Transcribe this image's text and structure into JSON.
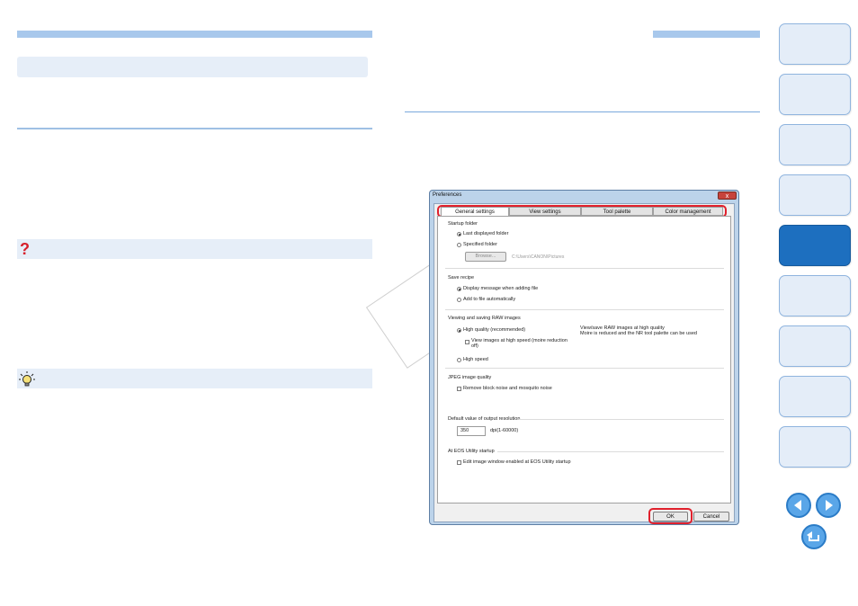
{
  "dialog": {
    "title": "Preferences",
    "close_glyph": "x",
    "tabs": [
      {
        "label": "General settings",
        "active": true
      },
      {
        "label": "View settings",
        "active": false
      },
      {
        "label": "Tool palette",
        "active": false
      },
      {
        "label": "Color management",
        "active": false
      }
    ],
    "startup_folder": {
      "heading": "Startup folder",
      "opt_last": "Last displayed folder",
      "opt_specified": "Specified folder",
      "browse_label": "Browse...",
      "path": "C:\\Users\\CANON\\Pictures"
    },
    "save_recipe": {
      "heading": "Save recipe",
      "opt_message": "Display message when adding file",
      "opt_auto": "Add to file automatically"
    },
    "viewing_raw": {
      "heading": "Viewing and saving RAW images",
      "opt_high_quality": "High quality (recommended)",
      "desc_line1": "View/save RAW images at high quality",
      "desc_line2": "Moire is reduced and the NR tool palette can be used",
      "chk_high_speed_view_line1": "View images at high speed (moire reduction",
      "chk_high_speed_view_line2": "off)",
      "opt_high_speed": "High speed"
    },
    "jpeg_quality": {
      "heading": "JPEG image quality",
      "chk_noise": "Remove block noise and mosquito noise"
    },
    "output_resolution": {
      "heading": "Default value of output resolution",
      "value": "350",
      "unit": "dpi(1-60000)"
    },
    "eos_startup": {
      "heading": "At EOS Utility startup",
      "chk_edit_window": "Edit image window enabled at EOS Utility startup"
    },
    "ok_label": "OK",
    "cancel_label": "Cancel"
  },
  "left_column": {
    "note_icon": "question-icon",
    "tip_icon": "lightbulb-icon",
    "note_glyph": "?"
  },
  "nav": {
    "tab_count": 9,
    "active_index": 4,
    "accent": "#1d6fbf",
    "prev_icon": "arrow-left-icon",
    "next_icon": "arrow-right-icon",
    "return_icon": "return-icon"
  },
  "colors": {
    "highlight_red": "#e0202c",
    "bar_blue": "#a8c8ec",
    "dialog_frame": "#bcd3ea"
  }
}
